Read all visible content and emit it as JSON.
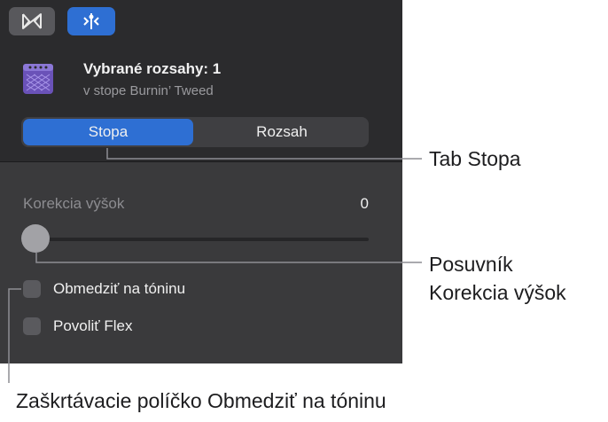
{
  "toolbar": {
    "buttons": [
      {
        "icon": "bowtie-icon"
      },
      {
        "icon": "region-inspector-icon",
        "active": true
      }
    ]
  },
  "header": {
    "icon": "amp-icon",
    "title": "Vybrané rozsahy: 1",
    "subtitle": "v stope Burnin’ Tweed"
  },
  "segmented": {
    "tabs": [
      {
        "label": "Stopa",
        "selected": true
      },
      {
        "label": "Rozsah",
        "selected": false
      }
    ]
  },
  "pitch_correction": {
    "label": "Korekcia výšok",
    "value": "0"
  },
  "checkboxes": [
    {
      "label": "Obmedziť na tóninu",
      "checked": false
    },
    {
      "label": "Povoliť Flex",
      "checked": false
    }
  ],
  "callouts": {
    "tab": "Tab Stopa",
    "slider_line1": "Posuvník",
    "slider_line2": "Korekcia výšok",
    "checkbox": "Zaškrtávacie políčko Obmedziť na tóninu"
  },
  "colors": {
    "accent": "#2e6fd3",
    "panel": "#3a3a3c",
    "amp": "#7a63c9"
  }
}
